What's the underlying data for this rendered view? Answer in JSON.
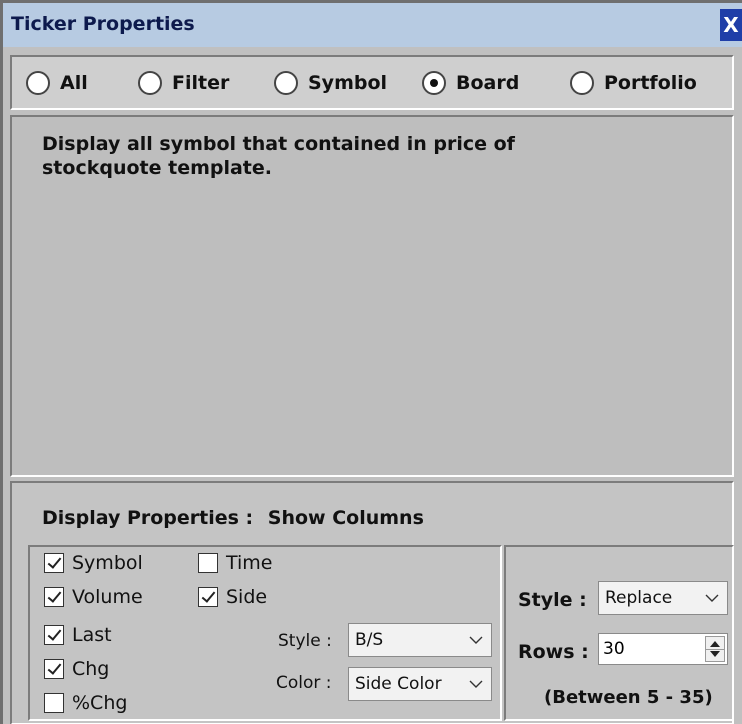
{
  "window": {
    "title": "Ticker Properties",
    "close_label": "X"
  },
  "modes": [
    {
      "label": "All",
      "checked": false
    },
    {
      "label": "Filter",
      "checked": false
    },
    {
      "label": "Symbol",
      "checked": false
    },
    {
      "label": "Board",
      "checked": true
    },
    {
      "label": "Portfolio",
      "checked": false
    }
  ],
  "description": "Display all symbol that contained  in price of stockquote template.",
  "display": {
    "heading": "Display Properties :",
    "subheading": "Show Columns",
    "columns": [
      {
        "label": "Symbol",
        "checked": true
      },
      {
        "label": "Volume",
        "checked": true
      },
      {
        "label": "Last",
        "checked": true
      },
      {
        "label": "Chg",
        "checked": true
      },
      {
        "label": "%Chg",
        "checked": false
      },
      {
        "label": "Time",
        "checked": false
      },
      {
        "label": "Side",
        "checked": true
      }
    ],
    "side_style_label": "Style :",
    "side_style_value": "B/S",
    "side_color_label": "Color :",
    "side_color_value": "Side Color",
    "style_label": "Style :",
    "style_value": "Replace",
    "rows_label": "Rows :",
    "rows_value": "30",
    "rows_hint": "(Between 5 - 35)"
  }
}
